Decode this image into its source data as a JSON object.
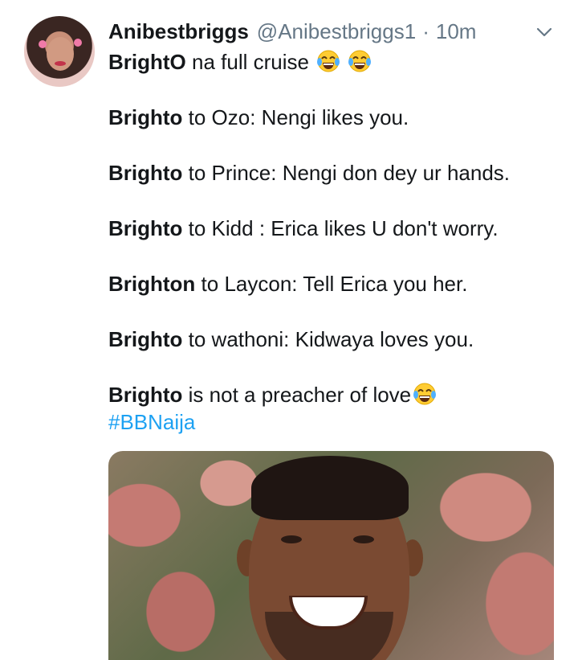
{
  "tweet": {
    "author_name": "Anibestbriggs",
    "handle": "@Anibestbriggs1",
    "separator": "·",
    "time": "10m",
    "lines": [
      {
        "bold": "BrightO",
        "text": " na full cruise"
      },
      {
        "bold": "Brighto",
        "text": " to Ozo: Nengi likes you."
      },
      {
        "bold": "Brighto",
        "text": " to Prince: Nengi don dey ur hands."
      },
      {
        "bold": "Brighto",
        "text": " to Kidd : Erica likes U don't worry."
      },
      {
        "bold": "Brighton",
        "text": " to Laycon: Tell Erica you her."
      },
      {
        "bold": "Brighto",
        "text": " to wathoni: Kidwaya loves you."
      },
      {
        "bold": "Brighto",
        "text": " is not a preacher of love"
      }
    ],
    "hashtag": "#BBNaija"
  },
  "icons": {
    "caret": "chevron-down-icon",
    "emoji": "tears-of-joy-emoji"
  },
  "colors": {
    "link": "#1da1f2",
    "muted": "#657786",
    "text": "#14171a"
  }
}
